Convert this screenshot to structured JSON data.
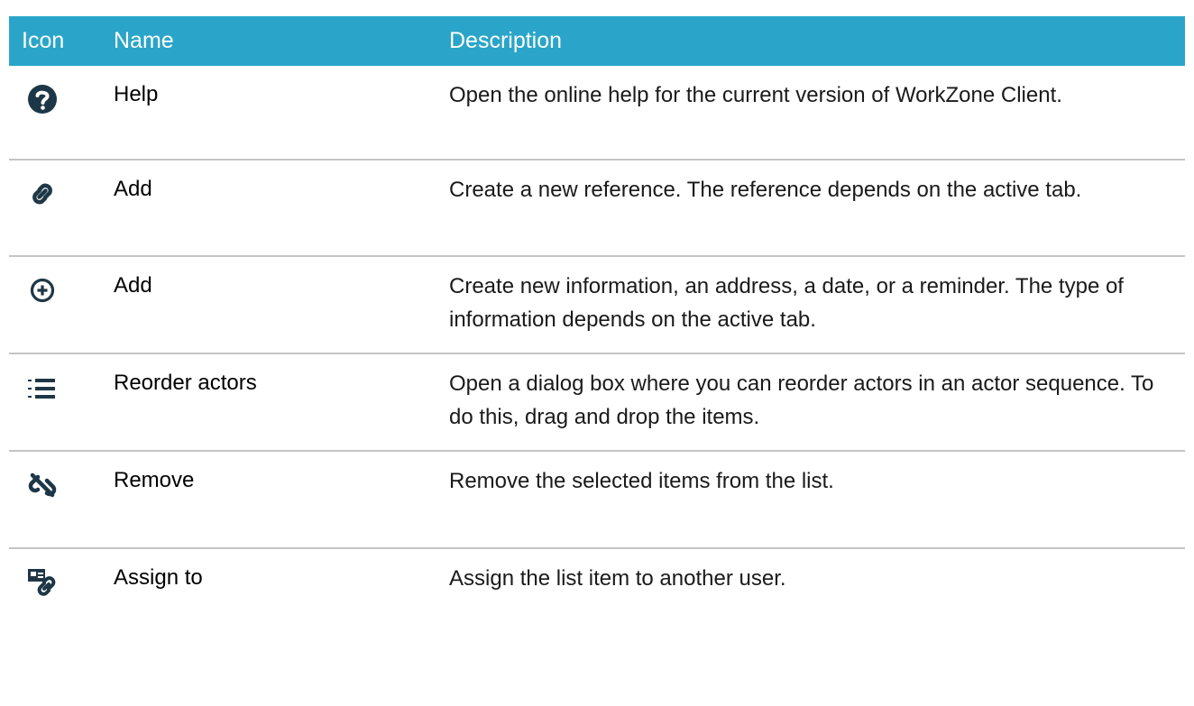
{
  "header": {
    "icon": "Icon",
    "name": "Name",
    "description": "Description"
  },
  "colors": {
    "header_bg": "#2aa5c9",
    "header_text": "#ffffff",
    "icon_color": "#1e3746",
    "divider": "#c4c4c4"
  },
  "rows": [
    {
      "icon": "help-icon",
      "name": "Help",
      "description": "Open the online help for the current version of WorkZone Client."
    },
    {
      "icon": "link-icon",
      "name": "Add",
      "description": "Create a new reference. The reference depends on the active tab."
    },
    {
      "icon": "add-circle-icon",
      "name": "Add",
      "description": "Create new information, an address, a date, or a reminder. The type of information depends on the active tab."
    },
    {
      "icon": "numbered-list-icon",
      "name": "Reorder actors",
      "description": "Open a dialog box where you can reorder actors in an actor sequence. To do this, drag and drop the items."
    },
    {
      "icon": "unlink-icon",
      "name": "Remove",
      "description": "Remove the selected items from the list."
    },
    {
      "icon": "assign-to-icon",
      "name": "Assign to",
      "description": "Assign the list item to another user."
    }
  ]
}
